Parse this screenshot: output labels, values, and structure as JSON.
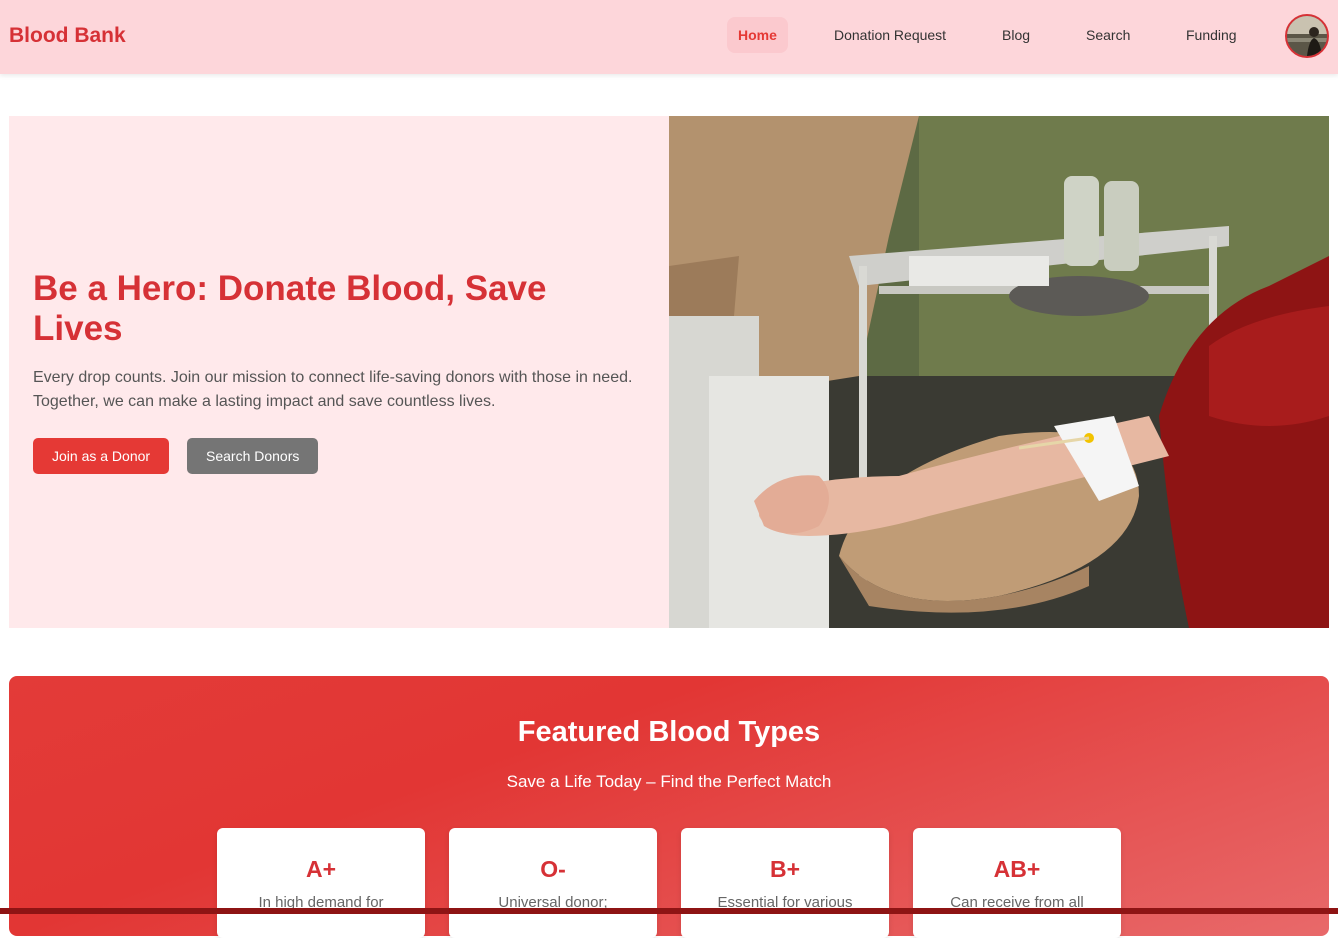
{
  "navbar": {
    "brand": "Blood Bank",
    "links": [
      {
        "label": "Home",
        "active": true
      },
      {
        "label": "Donation Request"
      },
      {
        "label": "Blog"
      },
      {
        "label": "Search"
      },
      {
        "label": "Funding"
      }
    ]
  },
  "hero": {
    "title": "Be a Hero: Donate Blood, Save Lives",
    "text": "Every drop counts. Join our mission to connect life-saving donors with those in need. Together, we can make a lasting impact and save countless lives.",
    "primary_button": "Join as a Donor",
    "secondary_button": "Search Donors"
  },
  "featured": {
    "title": "Featured Blood Types",
    "subtitle": "Save a Life Today – Find the Perfect Match",
    "cards": [
      {
        "type": "A+",
        "desc": "In high demand for"
      },
      {
        "type": "O-",
        "desc": "Universal donor;"
      },
      {
        "type": "B+",
        "desc": "Essential for various"
      },
      {
        "type": "AB+",
        "desc": "Can receive from all"
      }
    ]
  },
  "colors": {
    "accent": "#e53935",
    "brand": "#d63136",
    "navbar_bg": "#fdd6da",
    "hero_bg": "#ffe9eb"
  }
}
